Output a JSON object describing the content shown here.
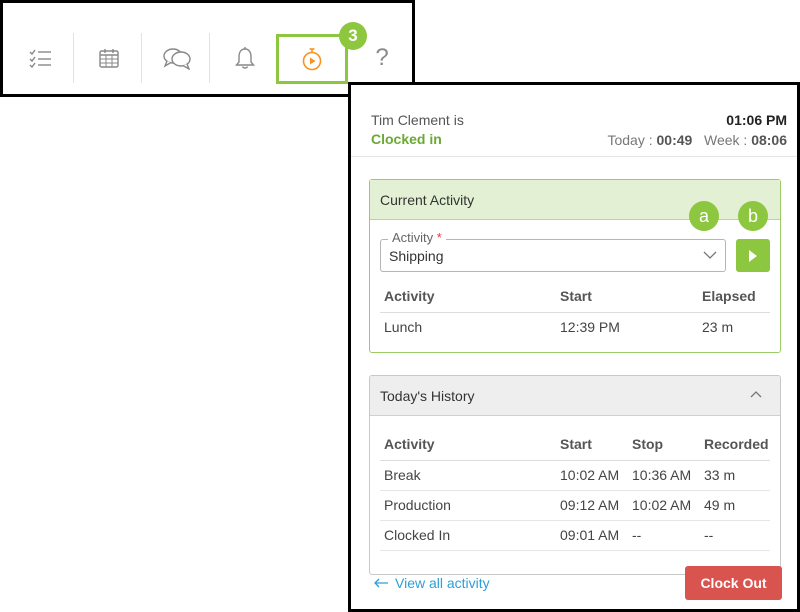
{
  "toolbar": {
    "items": [
      {
        "icon": "checklist-icon"
      },
      {
        "icon": "calendar-icon"
      },
      {
        "icon": "chat-icon"
      },
      {
        "icon": "bell-icon"
      },
      {
        "icon": "stopwatch-play-icon",
        "active": true
      },
      {
        "icon": "help-icon",
        "glyph": "?"
      }
    ],
    "step_badge": "3"
  },
  "panel": {
    "user_line": "Tim Clement is",
    "status": "Clocked in",
    "current_time": "01:06 PM",
    "today_label": "Today : ",
    "today_value": "00:49",
    "week_label": "Week : ",
    "week_value": "08:06"
  },
  "current_activity": {
    "title": "Current Activity",
    "badge_a": "a",
    "badge_b": "b",
    "field_label": "Activity",
    "required_mark": "*",
    "selected": "Shipping",
    "columns": [
      "Activity",
      "Start",
      "Elapsed"
    ],
    "rows": [
      [
        "Lunch",
        "12:39 PM",
        "23 m"
      ]
    ]
  },
  "history": {
    "title": "Today's History",
    "columns": [
      "Activity",
      "Start",
      "Stop",
      "Recorded"
    ],
    "rows": [
      [
        "Break",
        "10:02 AM",
        "10:36 AM",
        "33 m"
      ],
      [
        "Production",
        "09:12 AM",
        "10:02 AM",
        "49 m"
      ],
      [
        "Clocked In",
        "09:01 AM",
        "--",
        "--"
      ]
    ]
  },
  "footer": {
    "view_all": "View all activity",
    "clock_out": "Clock Out"
  },
  "colors": {
    "accent_green": "#8dc63f",
    "status_green": "#6aa933",
    "danger": "#d9534f",
    "link": "#2d9fd8"
  }
}
